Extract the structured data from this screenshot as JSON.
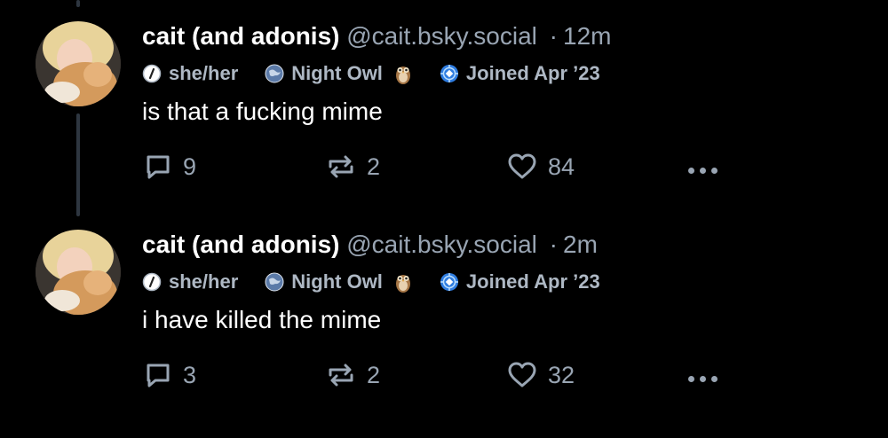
{
  "posts": [
    {
      "author_name": "cait (and adonis)",
      "handle": "@cait.bsky.social",
      "separator": "·",
      "time": "12m",
      "badges": {
        "pronouns": "she/her",
        "night_owl": "Night Owl",
        "joined": "Joined Apr ’23"
      },
      "text": "is that a fucking mime",
      "replies": "9",
      "reposts": "2",
      "likes": "84"
    },
    {
      "author_name": "cait (and adonis)",
      "handle": "@cait.bsky.social",
      "separator": "·",
      "time": "2m",
      "badges": {
        "pronouns": "she/her",
        "night_owl": "Night Owl",
        "joined": "Joined Apr ’23"
      },
      "text": "i have killed the mime",
      "replies": "3",
      "reposts": "2",
      "likes": "32"
    }
  ],
  "colors": {
    "background": "#000000",
    "muted": "#99a5b3",
    "badge_text": "#aeb8c4",
    "thread_line": "#2e3640",
    "joined_badge": "#3b82f6"
  },
  "icons": [
    "reply-icon",
    "repost-icon",
    "like-icon",
    "more-icon",
    "pronoun-icon",
    "globe-icon",
    "owl-icon",
    "joined-badge-icon"
  ]
}
